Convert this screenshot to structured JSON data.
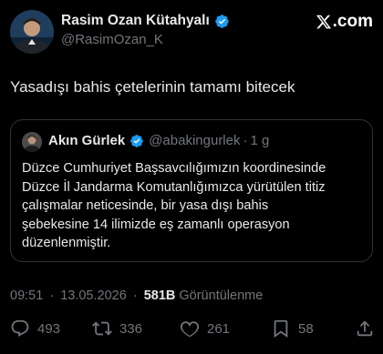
{
  "author": {
    "name": "Rasim Ozan Kütahyalı",
    "handle": "@RasimOzan_K"
  },
  "brand": {
    "logo_text": ".com"
  },
  "tweet": {
    "text": "Yasadışı bahis çetelerinin tamamı bitecek"
  },
  "quote": {
    "name": "Akın Gürlek",
    "handle": "@abakingurlek",
    "separator": "·",
    "age": "1 g",
    "lines": [
      "Düzce Cumhuriyet Başsavcılığımızın koordinesinde",
      "Düzce İl Jandarma Komutanlığımızca yürütülen titiz",
      "çalışmalar neticesinde, bir yasa dışı bahis",
      "şebekesine 14 ilimizde eş zamanlı operasyon",
      "düzenlenmiştir."
    ]
  },
  "meta": {
    "time": "09:51",
    "separator": "·",
    "date": "13.05.2026",
    "views_count": "581B",
    "views_label": "Görüntülenme"
  },
  "actions": {
    "replies": "493",
    "reposts": "336",
    "likes": "261",
    "bookmarks": "58"
  },
  "icons": [
    "verified-badge-icon",
    "x-logo-icon",
    "reply-icon",
    "repost-icon",
    "like-icon",
    "bookmark-icon",
    "share-icon"
  ],
  "colors": {
    "background": "#000000",
    "text": "#e7e9ea",
    "muted": "#71767b",
    "verified": "#1d9bf0",
    "border": "#2f3336"
  }
}
